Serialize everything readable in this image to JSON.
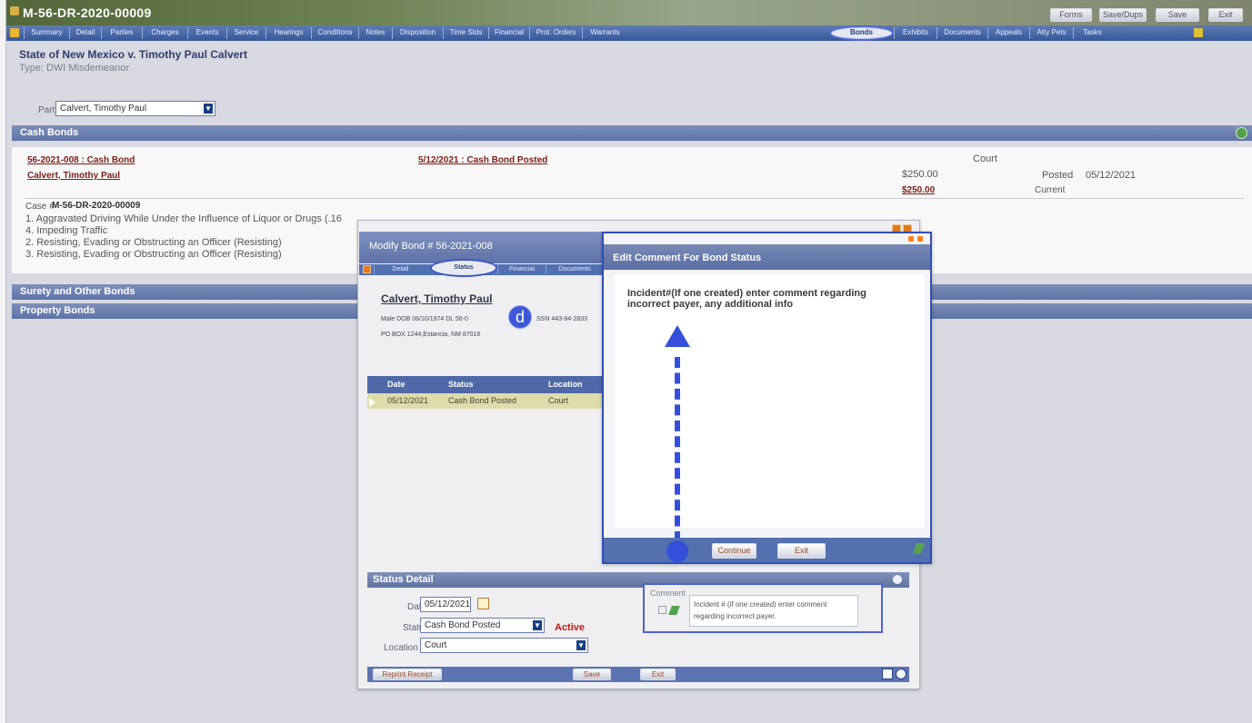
{
  "window": {
    "case_number": "M-56-DR-2020-00009",
    "buttons": [
      "Forms",
      "Save/Dups",
      "Save",
      "Exit"
    ]
  },
  "tabs": [
    "Summary",
    "Detail",
    "Parties",
    "Charges",
    "Events",
    "Service",
    "Hearings",
    "Conditions",
    "Notes",
    "Disposition",
    "Time Stds",
    "Financial",
    "Prot. Orders",
    "Warrants",
    "Bonds",
    "Exhibits",
    "Documents",
    "Appeals",
    "Atty Pets",
    "Tasks"
  ],
  "case": {
    "heading": "State of New Mexico v. Timothy Paul Calvert",
    "type": "Type: DWI Misdemeanor",
    "party_label": "Party",
    "party_value": "Calvert, Timothy Paul"
  },
  "cash_bonds": {
    "title": "Cash Bonds",
    "bond_link": "56-2021-008 : Cash Bond",
    "party_link": "Calvert, Timothy Paul",
    "status_link": "5/12/2021 : Cash Bond Posted",
    "court_label": "Court",
    "amount_1": "$250.00",
    "amount_2": "$250.00",
    "posted_label": "Posted",
    "posted_date": "05/12/2021",
    "current_label": "Current",
    "case_label": "Case #",
    "case_number": "M-56-DR-2020-00009",
    "charges": [
      "1. Aggravated Driving While Under the Influence of Liquor or Drugs (.16",
      "4. Impeding Traffic",
      "2. Resisting, Evading or Obstructing an Officer (Resisting)",
      "3. Resisting, Evading or Obstructing an Officer (Resisting)"
    ]
  },
  "surety_title": "Surety and Other Bonds",
  "property_title": "Property Bonds",
  "modify_bond": {
    "title": "Modify Bond # 56-2021-008",
    "tabs": [
      "Detail",
      "Status",
      "Financial",
      "Documents"
    ],
    "party_name": "Calvert, Timothy Paul",
    "meta_line_1": "Male   DOB 06/10/1974   DL 56-0",
    "meta_ssn": "SSN 443-84-2833",
    "meta_line_2": "PO BOX 1244,Estancia, NM 87016",
    "annotation": "d",
    "grid": {
      "headers": [
        "Date",
        "Status",
        "Location"
      ],
      "row": [
        "05/12/2021",
        "Cash Bond Posted",
        "Court"
      ]
    },
    "status_detail": {
      "title": "Status Detail",
      "date_label": "Date",
      "date_value": "05/12/2021",
      "status_label": "Status",
      "status_value": "Cash Bond Posted",
      "active": "Active",
      "location_label": "Location",
      "location_value": "Court",
      "comment_label": "Comment",
      "comment_value": "Incident # (if one created) enter comment regarding incorrect payer."
    },
    "footer": {
      "reprint": "Reprint Receipt",
      "save": "Save",
      "exit": "Exit"
    }
  },
  "comment_dialog": {
    "title": "Edit Comment For Bond Status",
    "body": "Incident#(If one created) enter comment regarding incorrect payer, any additional info",
    "buttons": [
      "Continue",
      "Exit"
    ]
  }
}
